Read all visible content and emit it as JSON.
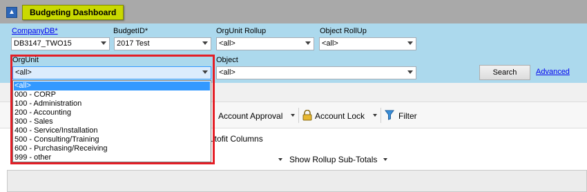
{
  "app": {
    "title": "Budgeting Dashboard"
  },
  "filters": {
    "companydb": {
      "label": "CompanyDB*",
      "value": "DB3147_TWO15"
    },
    "budgetid": {
      "label": "BudgetID*",
      "value": "2017 Test"
    },
    "orgunit_rollup": {
      "label": "OrgUnit Rollup",
      "value": "<all>"
    },
    "object_rollup": {
      "label": "Object RollUp",
      "value": "<all>"
    },
    "orgunit": {
      "label": "OrgUnit",
      "value": "<all>"
    },
    "object": {
      "label": "Object",
      "value": "<all>"
    },
    "search_label": "Search",
    "advanced_label": "Advanced"
  },
  "orgunit_options": [
    "<all>",
    "000 - CORP",
    "100 - Administration",
    "200 - Accounting",
    "300 - Sales",
    "400 - Service/Installation",
    "500 - Consulting/Training",
    "600 - Purchasing/Receiving",
    "999 - other"
  ],
  "toolbar": {
    "account_approval": "Account Approval",
    "account_lock": "Account Lock",
    "filter": "Filter",
    "autofit_columns": "utofit Columns",
    "show_rollup_subtotals": "Show Rollup Sub-Totals"
  },
  "colors": {
    "filter_bar": "#acd9ed",
    "title_badge": "#c9d900",
    "highlight": "#e41e26",
    "selection": "#3399ff"
  }
}
